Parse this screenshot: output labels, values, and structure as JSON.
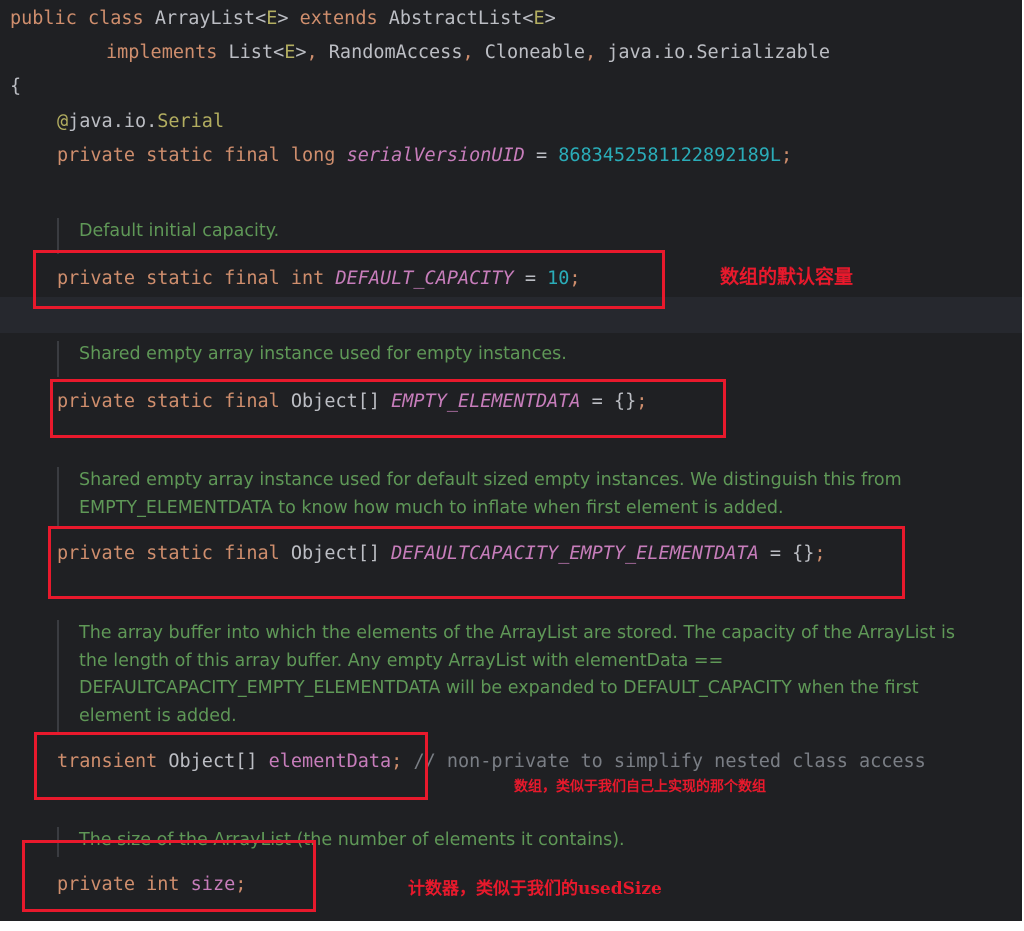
{
  "code": {
    "class_line": {
      "kw_public": "public",
      "kw_class": "class",
      "class_name": "ArrayList",
      "lt1": "<",
      "type_e1": "E",
      "gt1": ">",
      "kw_extends": "extends",
      "parent": "AbstractList",
      "lt2": "<",
      "type_e2": "E",
      "gt2": ">"
    },
    "implements_line": {
      "kw_implements": "implements",
      "list": "List",
      "lt": "<",
      "type_e": "E",
      "gt": ">",
      "comma1": ",",
      "random_access": "RandomAccess",
      "comma2": ",",
      "cloneable": "Cloneable",
      "comma3": ",",
      "serializable": "java.io.Serializable"
    },
    "open_brace": "{",
    "annotation": {
      "at": "@",
      "pkg": "java.io.",
      "name": "Serial"
    },
    "serial_line": {
      "mods": "private static final long",
      "name": "serialVersionUID",
      "eq": "=",
      "value": "8683452581122892189L",
      "semi": ";"
    },
    "default_capacity": {
      "doc": "Default initial capacity.",
      "mods": "private static final int",
      "name": "DEFAULT_CAPACITY",
      "eq": "=",
      "value": "10",
      "semi": ";"
    },
    "empty_elementdata": {
      "doc": "Shared empty array instance used for empty instances.",
      "mods": "private static final",
      "type": "Object[]",
      "name": "EMPTY_ELEMENTDATA",
      "rest": "= {}",
      "semi": ";"
    },
    "defaultcapacity_empty": {
      "doc": "Shared empty array instance used for default sized empty instances. We distinguish this from\nEMPTY_ELEMENTDATA to know how much to inflate when first element is added.",
      "mods": "private static final",
      "type": "Object[]",
      "name": "DEFAULTCAPACITY_EMPTY_ELEMENTDATA",
      "rest": "= {}",
      "semi": ";"
    },
    "element_data": {
      "doc": "The array buffer into which the elements of the ArrayList are stored. The capacity of the ArrayList is\nthe length of this array buffer. Any empty ArrayList with elementData ==\nDEFAULTCAPACITY_EMPTY_ELEMENTDATA will be expanded to DEFAULT_CAPACITY when the first\nelement is added.",
      "mods": "transient",
      "type": "Object[]",
      "name": "elementData",
      "semi": ";",
      "comment": "// non-private to simplify nested class access"
    },
    "size_field": {
      "doc": "The size of the ArrayList (the number of elements it contains).",
      "mods": "private int",
      "name": "size",
      "semi": ";"
    }
  },
  "annotations": {
    "default_capacity_note": "数组的默认容量",
    "element_data_note": "数组，类似于我们自己上实现的那个数组",
    "size_note": "计数器，类似于我们的usedSize"
  },
  "colors": {
    "background": "#1f2023",
    "keyword": "#cf8e6d",
    "constant": "#c77dbb",
    "number": "#2aacb8",
    "doc_comment": "#5f9857",
    "line_comment": "#7a7e85",
    "annotation_text": "#e8192c"
  }
}
